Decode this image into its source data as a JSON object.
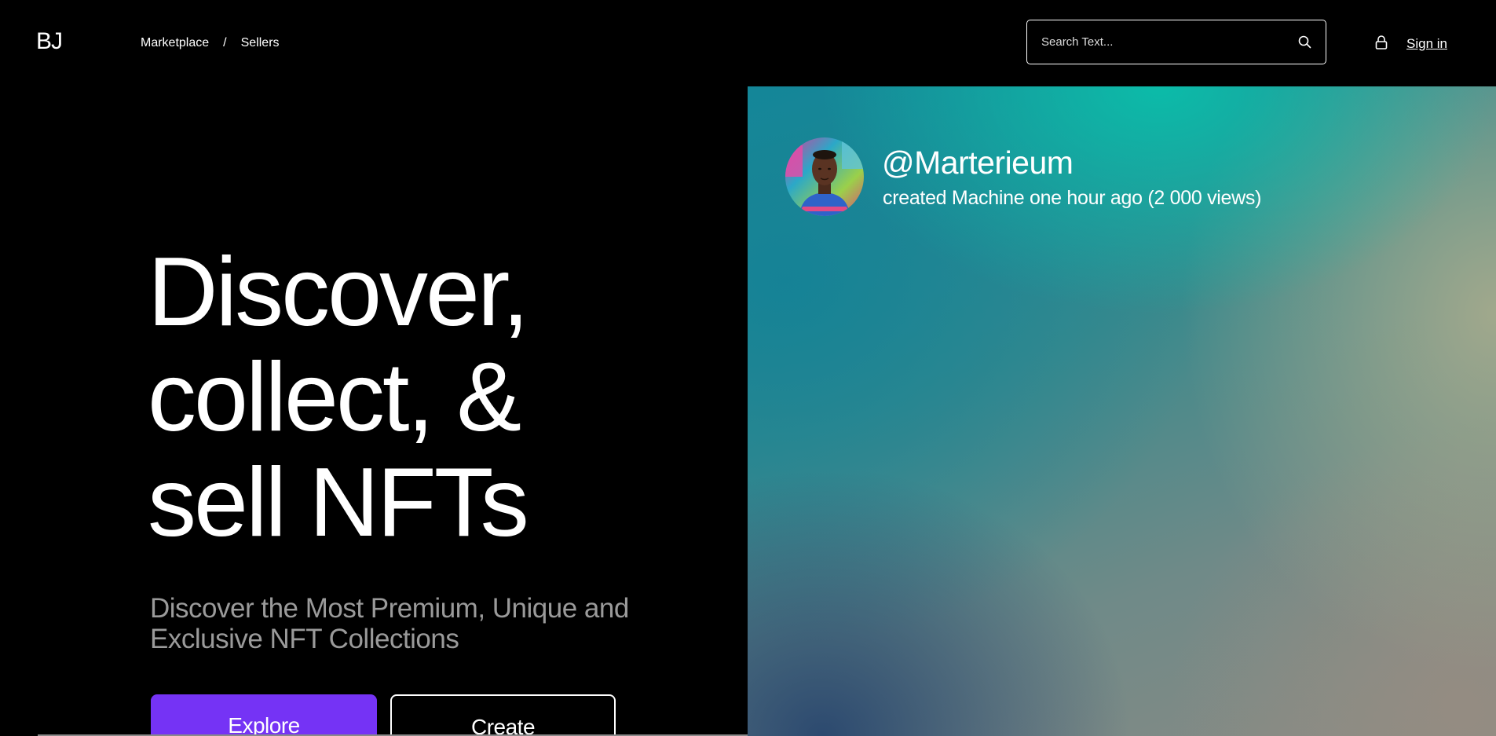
{
  "header": {
    "logo": "BJ",
    "breadcrumb": {
      "items": [
        "Marketplace",
        "Sellers"
      ],
      "separator": "/"
    },
    "search": {
      "placeholder": "Search Text...",
      "icon": "search-icon"
    },
    "lock_icon": "lock-icon",
    "sign_in_label": "Sign in"
  },
  "hero": {
    "title_lines": [
      "Discover,",
      "collect, &",
      "sell NFTs"
    ],
    "subtitle": "Discover the Most Premium, Unique and Exclusive NFT Collections",
    "explore_label": "Explore",
    "create_label": "Create"
  },
  "featured": {
    "handle": "@Marterieum",
    "meta": "created Machine one hour ago (2 000 views)"
  },
  "colors": {
    "background": "#000000",
    "accent": "#7533f5",
    "subtitle": "#9a9a9a"
  }
}
